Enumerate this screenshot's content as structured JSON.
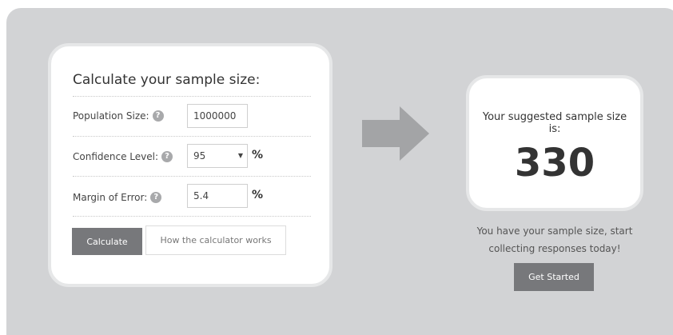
{
  "calculator": {
    "title": "Calculate your sample size:",
    "population": {
      "label": "Population Size:",
      "value": "1000000"
    },
    "confidence": {
      "label": "Confidence Level:",
      "value": "95",
      "unit": "%"
    },
    "margin": {
      "label": "Margin of Error:",
      "value": "5.4",
      "unit": "%"
    },
    "help_glyph": "?",
    "calculate_label": "Calculate",
    "how_label": "How the calculator works"
  },
  "result": {
    "label": "Your suggested sample size is:",
    "value": "330",
    "promo": "You have your sample size, start collecting responses today!",
    "cta_label": "Get Started"
  },
  "icons": {
    "arrow": "arrow-right-icon",
    "help": "help-icon",
    "dropdown": "chevron-down-icon"
  },
  "colors": {
    "panel": "#d2d3d5",
    "button": "#77787b",
    "arrow": "#a3a4a6"
  }
}
